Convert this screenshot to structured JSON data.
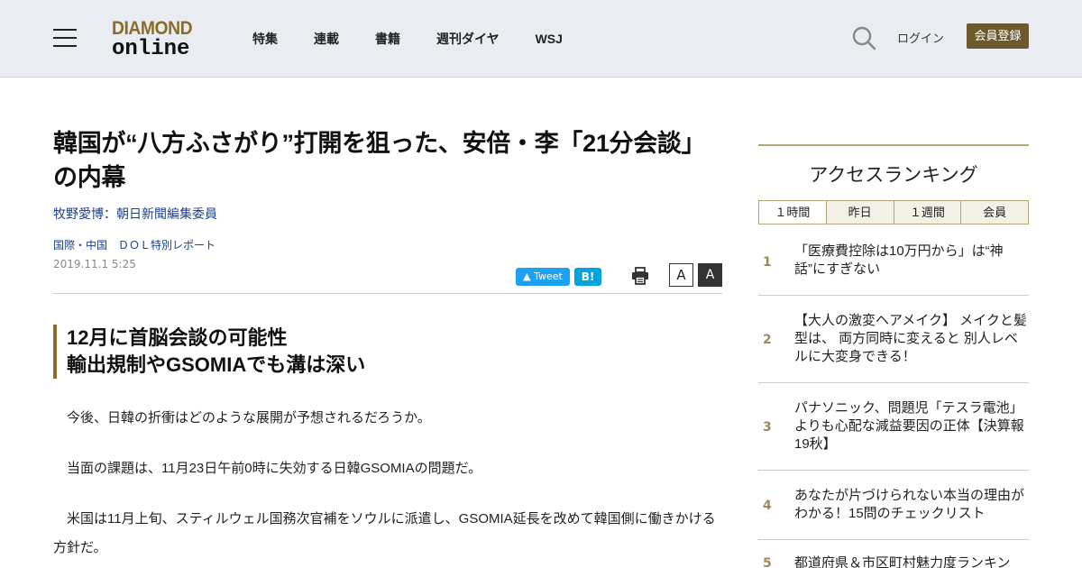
{
  "header": {
    "logo_top": "DIAMOND",
    "logo_bottom": "online",
    "nav": [
      "特集",
      "連載",
      "書籍",
      "週刊ダイヤ",
      "WSJ"
    ],
    "login_label": "ログイン",
    "register_label": "会員登録"
  },
  "article": {
    "title": "韓国が“八方ふさがり”打開を狙った、安倍・李「21分会談」の内幕",
    "author": "牧野愛博：朝日新聞編集委員",
    "category": "国際・中国　ＤＯＬ特別レポート",
    "date": "2019.11.1 5:25",
    "tweet_label": "Tweet",
    "hatena_label": "B!",
    "font_small_label": "A",
    "font_large_label": "A",
    "subhead_line1": "12月に首脳会談の可能性",
    "subhead_line2": "輸出規制やGSOMIAでも溝は深い",
    "paragraphs": [
      "今後、日韓の折衝はどのような展開が予想されるだろうか。",
      "当面の課題は、11月23日午前0時に失効する日韓GSOMIAの問題だ。",
      "米国は11月上旬、スティルウェル国務次官補をソウルに派遣し、GSOMIA延長を改めて韓国側に働きかける方針だ。"
    ]
  },
  "sidebar": {
    "title": "アクセスランキング",
    "tabs": [
      "１時間",
      "昨日",
      "１週間",
      "会員"
    ],
    "ranking": [
      {
        "num": "1",
        "text": "「医療費控除は10万円から」は“神話”にすぎない"
      },
      {
        "num": "2",
        "text": "【大人の激変ヘアメイク】 メイクと髪型は、 両方同時に変えると 別人レベルに大変身できる！"
      },
      {
        "num": "3",
        "text": "パナソニック、問題児「テスラ電池」よりも心配な減益要因の正体【決算報19秋】"
      },
      {
        "num": "4",
        "text": "あなたが片づけられない本当の理由がわかる！15問のチェックリスト"
      },
      {
        "num": "5",
        "text": "都道府県＆市区町村魅力度ランキン"
      }
    ]
  }
}
